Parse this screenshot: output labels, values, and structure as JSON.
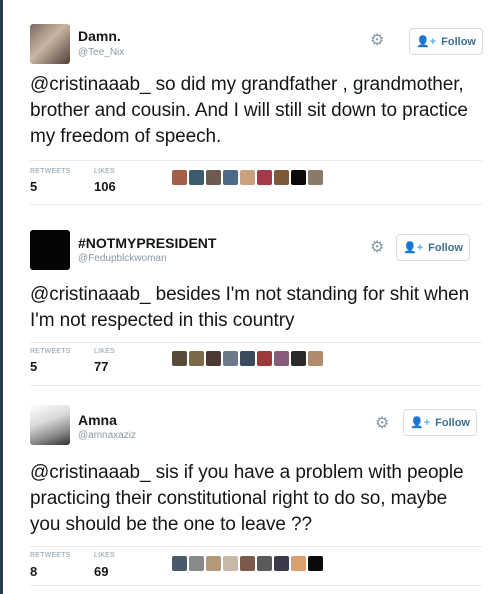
{
  "follow_label": "Follow",
  "retweets_label": "RETWEETS",
  "likes_label": "LIKES",
  "tweets": [
    {
      "name": "Damn.",
      "handle": "@Tee_Nix",
      "text": "@cristinaaab_ so did my grandfather , grandmother, brother and cousin. And I will still sit down to practice my freedom of speech.",
      "retweets": "5",
      "likes": "106"
    },
    {
      "name": "#NOTMYPRESIDENT",
      "handle": "@Fedupblckwoman",
      "text": "@cristinaaab_ besides I'm not standing for shit when I'm not respected in this country",
      "retweets": "5",
      "likes": "77"
    },
    {
      "name": "Amna",
      "handle": "@amnaxaziz",
      "text": "@cristinaaab_ sis if you have a problem with people practicing their constitutional right to do so, maybe you should be the one to leave ??",
      "retweets": "8",
      "likes": "69"
    }
  ],
  "colors": {
    "name": "#14171a",
    "handle": "#8899a6",
    "follow_text": "#3d6e92",
    "follow_icon": "#55acee",
    "divider": "#e6ecf0"
  }
}
